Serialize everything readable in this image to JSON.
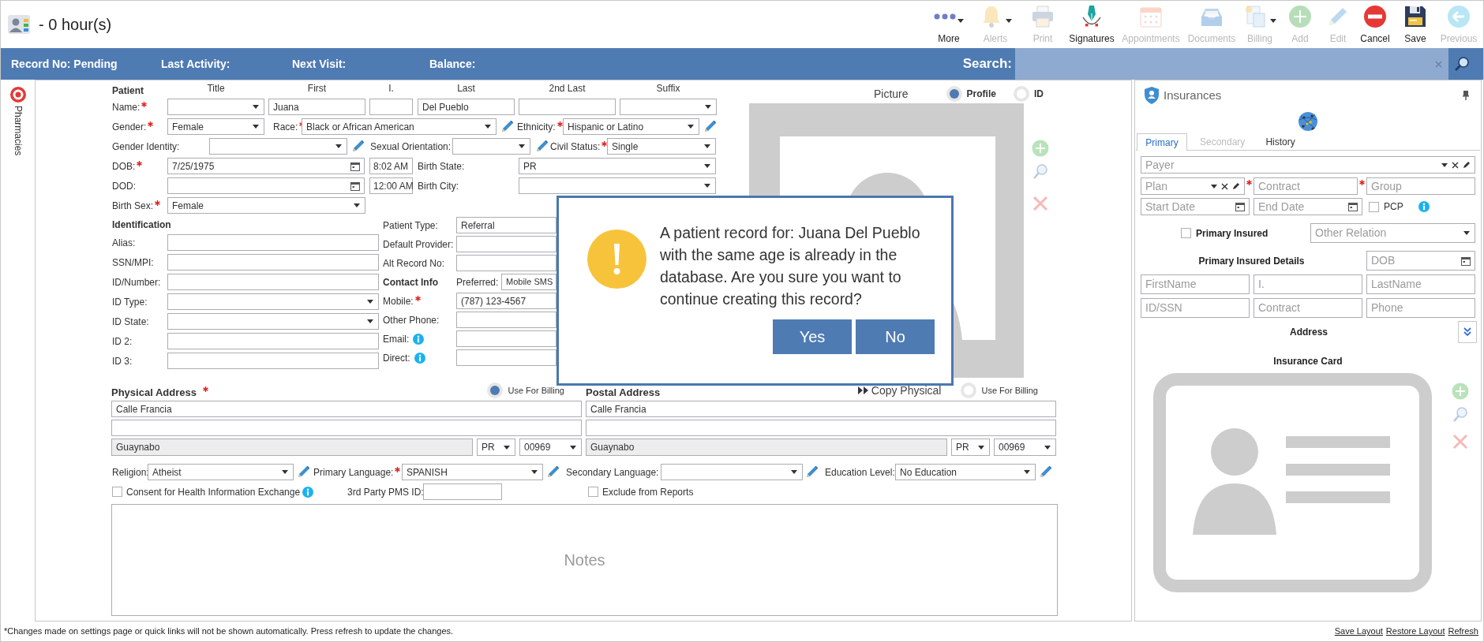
{
  "header": {
    "title": "- 0 hour(s)"
  },
  "toolbar": [
    {
      "label": "More",
      "kind": "more",
      "disabled": false,
      "menu": true
    },
    {
      "label": "Alerts",
      "kind": "bell",
      "disabled": true,
      "menu": true
    },
    {
      "label": "Print",
      "kind": "printer",
      "disabled": true,
      "menu": false
    },
    {
      "label": "Signatures",
      "kind": "pen",
      "disabled": false,
      "menu": false
    },
    {
      "label": "Appointments",
      "kind": "calendar",
      "disabled": true,
      "menu": false
    },
    {
      "label": "Documents",
      "kind": "tray",
      "disabled": true,
      "menu": false
    },
    {
      "label": "Billing",
      "kind": "invoice",
      "disabled": true,
      "menu": true
    },
    {
      "label": "Add",
      "kind": "add",
      "disabled": true,
      "menu": false
    },
    {
      "label": "Edit",
      "kind": "pencil",
      "disabled": true,
      "menu": false
    },
    {
      "label": "Cancel",
      "kind": "cancel",
      "disabled": false,
      "menu": false
    },
    {
      "label": "Save",
      "kind": "save",
      "disabled": false,
      "menu": false
    },
    {
      "label": "Previous",
      "kind": "previous",
      "disabled": true,
      "menu": false
    }
  ],
  "info_bar": {
    "items": [
      "Record No: Pending",
      "Last Activity:",
      "Next Visit:",
      "Balance:"
    ],
    "search": {
      "label": "Search:"
    }
  },
  "side_tabs": [
    {
      "label": "Pharmacies"
    }
  ],
  "patient": {
    "title": "Patient",
    "name_columns": [
      "Title",
      "First",
      "I.",
      "Last",
      "2nd Last",
      "Suffix"
    ],
    "rows": [
      {
        "items": [
          {
            "kind": "label",
            "text": "Name:",
            "required": true
          },
          {
            "kind": "select"
          },
          {
            "kind": "input",
            "value": "Juana"
          },
          {
            "kind": "input"
          },
          {
            "kind": "input",
            "value": "Del Pueblo"
          },
          {
            "kind": "input"
          },
          {
            "kind": "select"
          }
        ]
      },
      {
        "items": [
          {
            "kind": "label",
            "text": "Gender:",
            "required": true
          },
          {
            "kind": "select",
            "value": "Female"
          },
          {
            "kind": "label",
            "text": "Race:",
            "required": true
          },
          {
            "kind": "select",
            "value": "Black or African American"
          },
          {
            "kind": "edit"
          },
          {
            "kind": "label",
            "text": "Ethnicity:",
            "required": true
          },
          {
            "kind": "select",
            "value": "Hispanic or Latino"
          },
          {
            "kind": "edit"
          }
        ]
      },
      {
        "items": [
          {
            "kind": "label",
            "text": "Gender Identity:"
          },
          {
            "kind": "select"
          },
          {
            "kind": "edit"
          },
          {
            "kind": "label",
            "text": "Sexual Orientation:"
          },
          {
            "kind": "select"
          },
          {
            "kind": "edit"
          },
          {
            "kind": "label",
            "text": "Civil Status:",
            "required": true
          },
          {
            "kind": "select",
            "value": "Single"
          }
        ]
      },
      {
        "items": [
          {
            "kind": "label",
            "text": "DOB:",
            "required": true
          },
          {
            "kind": "date",
            "value": "7/25/1975"
          },
          {
            "kind": "time",
            "value": "8:02 AM"
          },
          {
            "kind": "label",
            "text": "Birth State:"
          },
          {
            "kind": "select",
            "value": "PR"
          }
        ]
      },
      {
        "items": [
          {
            "kind": "label",
            "text": "DOD:"
          },
          {
            "kind": "date"
          },
          {
            "kind": "time",
            "value": "12:00 AM"
          },
          {
            "kind": "label",
            "text": "Birth City:"
          },
          {
            "kind": "select"
          }
        ]
      },
      {
        "items": [
          {
            "kind": "label",
            "text": "Birth Sex:",
            "required": true
          },
          {
            "kind": "select",
            "value": "Female"
          }
        ]
      }
    ]
  },
  "identification": {
    "title": "Identification",
    "rows": [
      {
        "items": [
          {
            "kind": "label",
            "text": "Alias:"
          },
          {
            "kind": "input"
          }
        ]
      },
      {
        "items": [
          {
            "kind": "label",
            "text": "SSN/MPI:"
          },
          {
            "kind": "input"
          }
        ]
      },
      {
        "items": [
          {
            "kind": "label",
            "text": "ID/Number:"
          },
          {
            "kind": "input"
          }
        ]
      },
      {
        "items": [
          {
            "kind": "label",
            "text": "ID Type:"
          },
          {
            "kind": "select"
          }
        ]
      },
      {
        "items": [
          {
            "kind": "label",
            "text": "ID State:"
          },
          {
            "kind": "select"
          }
        ]
      },
      {
        "items": [
          {
            "kind": "label",
            "text": "ID 2:"
          },
          {
            "kind": "input"
          }
        ]
      },
      {
        "items": [
          {
            "kind": "label",
            "text": "ID 3:"
          },
          {
            "kind": "input"
          }
        ]
      }
    ]
  },
  "contact": {
    "rows": [
      {
        "items": [
          {
            "kind": "label",
            "text": "Patient Type:"
          },
          {
            "kind": "input",
            "value": "Referral"
          }
        ]
      },
      {
        "items": [
          {
            "kind": "label",
            "text": "Default Provider:"
          },
          {
            "kind": "input"
          }
        ]
      },
      {
        "items": [
          {
            "kind": "label",
            "text": "Alt Record No:"
          },
          {
            "kind": "input"
          }
        ]
      },
      {
        "items": [
          {
            "kind": "heading",
            "text": "Contact Info"
          },
          {
            "kind": "label",
            "text": "Preferred:"
          },
          {
            "kind": "input",
            "value": "Mobile SMS"
          }
        ]
      },
      {
        "items": [
          {
            "kind": "label",
            "text": "Mobile:",
            "required": true
          },
          {
            "kind": "input",
            "value": "(787) 123-4567"
          }
        ]
      },
      {
        "items": [
          {
            "kind": "label",
            "text": "Other Phone:"
          },
          {
            "kind": "input"
          }
        ]
      },
      {
        "items": [
          {
            "kind": "label",
            "text": "Email:",
            "info": true
          },
          {
            "kind": "input"
          }
        ]
      },
      {
        "items": [
          {
            "kind": "label",
            "text": "Direct:",
            "info": true
          },
          {
            "kind": "input"
          }
        ]
      }
    ]
  },
  "picture": {
    "label": "Picture",
    "options": [
      {
        "label": "Profile",
        "selected": true
      },
      {
        "label": "ID",
        "selected": false
      }
    ]
  },
  "addresses": [
    {
      "title": "Physical Address",
      "required": true,
      "use_for_billing": {
        "label": "Use For Billing",
        "selected": true
      },
      "line1": "Calle Francia",
      "city": "Guaynabo",
      "state": "PR",
      "zip": "00969"
    },
    {
      "title": "Postal Address",
      "required": false,
      "copy_button": "Copy Physical",
      "use_for_billing": {
        "label": "Use For Billing",
        "selected": false
      },
      "line1": "Calle Francia",
      "city": "Guaynabo",
      "state": "PR",
      "zip": "00969"
    }
  ],
  "other_rows": [
    {
      "items": [
        {
          "kind": "label",
          "text": "Religion:"
        },
        {
          "kind": "select",
          "value": "Atheist"
        },
        {
          "kind": "edit"
        },
        {
          "kind": "label",
          "text": "Primary Language:",
          "required": true
        },
        {
          "kind": "select",
          "value": "SPANISH"
        },
        {
          "kind": "edit"
        },
        {
          "kind": "label",
          "text": "Secondary Language:"
        },
        {
          "kind": "select"
        },
        {
          "kind": "edit"
        },
        {
          "kind": "label",
          "text": "Education Level:"
        },
        {
          "kind": "select",
          "value": "No Education"
        },
        {
          "kind": "edit"
        }
      ]
    },
    {
      "items": [
        {
          "kind": "checkbox",
          "label": "Consent for Health Information Exchange",
          "checked": false,
          "info": true
        },
        {
          "kind": "label",
          "text": "3rd Party PMS ID:"
        },
        {
          "kind": "input"
        },
        {
          "kind": "checkbox",
          "label": "Exclude from Reports",
          "checked": false
        }
      ]
    }
  ],
  "notes": {
    "placeholder": "Notes"
  },
  "dialog": {
    "message": "A patient record for: Juana Del Pueblo with the same age is already in the database. Are you sure you want to continue creating this record?",
    "buttons": [
      "Yes",
      "No"
    ]
  },
  "insurances": {
    "title": "Insurances",
    "tabs": [
      {
        "label": "Primary",
        "selected": true,
        "disabled": false
      },
      {
        "label": "Secondary",
        "selected": false,
        "disabled": true
      },
      {
        "label": "History",
        "selected": false,
        "disabled": false
      }
    ],
    "payer": {
      "placeholder": "Payer"
    },
    "plan_row": [
      {
        "placeholder": "Plan",
        "kind": "combo"
      },
      {
        "placeholder": "Contract",
        "kind": "input",
        "required": true
      },
      {
        "placeholder": "Group",
        "kind": "input",
        "required": true
      }
    ],
    "date_row": [
      {
        "placeholder": "Start Date"
      },
      {
        "placeholder": "End Date"
      }
    ],
    "pcp": {
      "label": "PCP",
      "checked": false
    },
    "primary_insured": {
      "label": "Primary Insured",
      "checked": false
    },
    "relation": {
      "placeholder": "Other Relation"
    },
    "details_title": "Primary Insured Details",
    "dob": {
      "placeholder": "DOB"
    },
    "details_rows": [
      [
        "FirstName",
        "I.",
        "LastName"
      ],
      [
        "ID/SSN",
        "Contract",
        "Phone"
      ]
    ],
    "address_label": "Address",
    "card_label": "Insurance Card"
  },
  "footer": {
    "note": "*Changes made on settings page or quick links will not be shown automatically. Press refresh to update the changes.",
    "links": [
      "Save Layout",
      "Restore Layout",
      "Refresh"
    ]
  }
}
